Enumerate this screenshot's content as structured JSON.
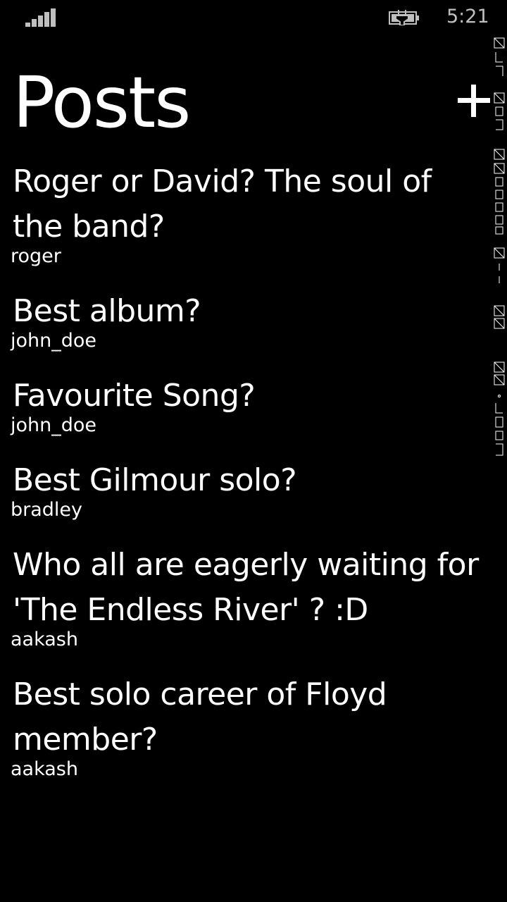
{
  "status_bar": {
    "time": "5:21",
    "signal_icon": "signal-strength-icon",
    "battery_icon": "battery-charging-icon"
  },
  "header": {
    "title": "Posts",
    "add_label": "+"
  },
  "posts": [
    {
      "title": "Roger or David? The soul of the band?",
      "author": "roger"
    },
    {
      "title": "Best album?",
      "author": "john_doe"
    },
    {
      "title": "Favourite Song?",
      "author": "john_doe"
    },
    {
      "title": "Best Gilmour solo?",
      "author": "bradley"
    },
    {
      "title": "Who all are eagerly waiting for 'The Endless River' ? :D",
      "author": "aakash"
    },
    {
      "title": "Best solo career of Floyd member?",
      "author": "aakash"
    }
  ],
  "colors": {
    "background": "#000000",
    "text": "#ffffff",
    "status": "#bfbfbf"
  }
}
